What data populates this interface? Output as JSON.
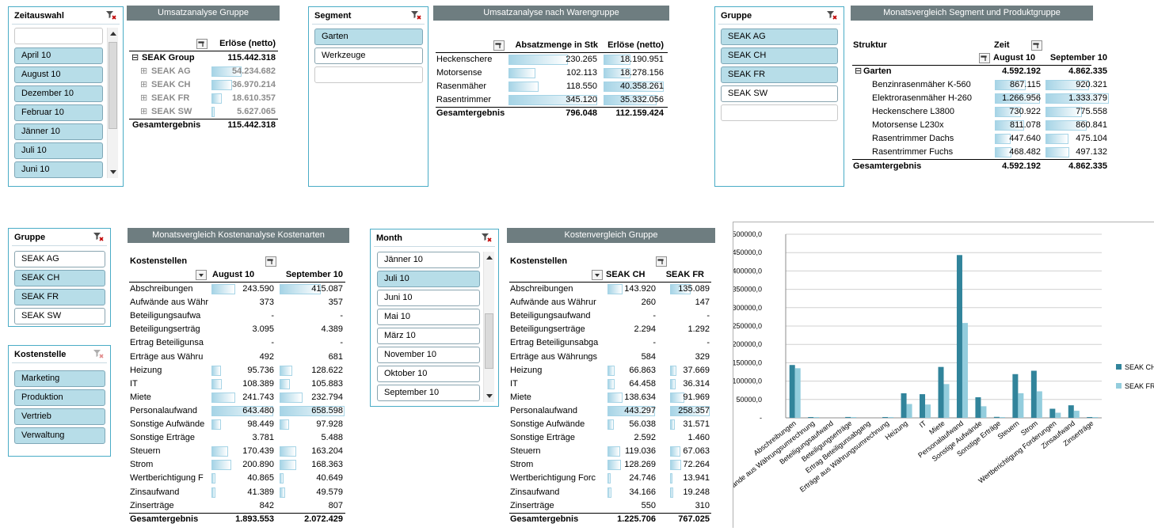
{
  "slicers": {
    "zeitauswahl": {
      "title": "Zeitauswahl",
      "items": [
        "",
        "April 10",
        "August 10",
        "Dezember 10",
        "Februar 10",
        "Jänner 10",
        "Juli 10",
        "Juni 10"
      ]
    },
    "segment": {
      "title": "Segment",
      "items": [
        "Garten",
        "Werkzeuge",
        ""
      ]
    },
    "gruppe_top": {
      "title": "Gruppe",
      "items": [
        "SEAK AG",
        "SEAK CH",
        "SEAK FR",
        "SEAK SW",
        ""
      ]
    },
    "gruppe_bottom": {
      "title": "Gruppe",
      "items": [
        "SEAK AG",
        "SEAK CH",
        "SEAK FR",
        "SEAK SW"
      ]
    },
    "kostenstelle": {
      "title": "Kostenstelle",
      "items": [
        "Marketing",
        "Produktion",
        "Vertrieb",
        "Verwaltung"
      ]
    },
    "month": {
      "title": "Month",
      "items": [
        "Jänner 10",
        "Juli 10",
        "Juni 10",
        "Mai 10",
        "März 10",
        "November 10",
        "Oktober 10",
        "September 10"
      ]
    }
  },
  "umsatz_gruppe": {
    "title": "Umsatzanalyse Gruppe",
    "header": "Erlöse (netto)",
    "rows": [
      {
        "label": "SEAK Group",
        "value": "115.442.318",
        "bar": 1.0
      },
      {
        "label": "SEAK AG",
        "value": "54.234.682",
        "bar": 0.47
      },
      {
        "label": "SEAK CH",
        "value": "36.970.214",
        "bar": 0.32
      },
      {
        "label": "SEAK FR",
        "value": "18.610.357",
        "bar": 0.16
      },
      {
        "label": "SEAK SW",
        "value": "5.627.065",
        "bar": 0.05
      }
    ],
    "total_label": "Gesamtergebnis",
    "total_value": "115.442.318"
  },
  "umsatz_waren": {
    "title": "Umsatzanalyse nach Warengruppe",
    "header1": "Absatzmenge in Stk",
    "header2": "Erlöse (netto)",
    "rows": [
      {
        "label": "Heckenschere",
        "v1": "230.265",
        "v2": "18.190.951",
        "b1": 0.67,
        "b2": 0.45
      },
      {
        "label": "Motorsense",
        "v1": "102.113",
        "v2": "18.278.156",
        "b1": 0.3,
        "b2": 0.45
      },
      {
        "label": "Rasenmäher",
        "v1": "118.550",
        "v2": "40.358.261",
        "b1": 0.34,
        "b2": 1.0
      },
      {
        "label": "Rasentrimmer",
        "v1": "345.120",
        "v2": "35.332.056",
        "b1": 1.0,
        "b2": 0.88
      }
    ],
    "total_label": "Gesamtergebnis",
    "total_v1": "796.048",
    "total_v2": "112.159.424"
  },
  "monatsvergleich_segment": {
    "title": "Monatsvergleich Segment und Produktgruppe",
    "h_struktur": "Struktur",
    "h_zeit": "Zeit",
    "h_aug": "August 10",
    "h_sep": "September 10",
    "group_label": "Garten",
    "group_aug": "4.592.192",
    "group_sep": "4.862.335",
    "rows": [
      {
        "label": "Benzinrasenmäher K-560",
        "aug": "867.115",
        "sep": "920.321",
        "ba": 0.65,
        "bs": 0.69
      },
      {
        "label": "Elektrorasenmäher H-260",
        "aug": "1.266.956",
        "sep": "1.333.379",
        "ba": 0.95,
        "bs": 1.0
      },
      {
        "label": "Heckenschere L3800",
        "aug": "730.922",
        "sep": "775.558",
        "ba": 0.55,
        "bs": 0.58
      },
      {
        "label": "Motorsense L230x",
        "aug": "811.078",
        "sep": "860.841",
        "ba": 0.61,
        "bs": 0.65
      },
      {
        "label": "Rasentrimmer Dachs",
        "aug": "447.640",
        "sep": "475.104",
        "ba": 0.34,
        "bs": 0.36
      },
      {
        "label": "Rasentrimmer Fuchs",
        "aug": "468.482",
        "sep": "497.132",
        "ba": 0.35,
        "bs": 0.37
      }
    ],
    "total_label": "Gesamtergebnis",
    "total_aug": "4.592.192",
    "total_sep": "4.862.335"
  },
  "kostenarten": {
    "title": "Monatsvergleich Kostenanalyse Kostenarten",
    "h_kst": "Kostenstellen",
    "h_aug": "August 10",
    "h_sep": "September 10",
    "rows": [
      {
        "label": "Abschreibungen",
        "aug": "243.590",
        "sep": "415.087",
        "ba": 0.37,
        "bs": 0.63
      },
      {
        "label": "Aufwände aus Währ",
        "aug": "373",
        "sep": "357",
        "ba": 0,
        "bs": 0
      },
      {
        "label": "Beteiligungsaufwa",
        "aug": "-",
        "sep": "-",
        "ba": 0,
        "bs": 0
      },
      {
        "label": "Beteiligungserträg",
        "aug": "3.095",
        "sep": "4.389",
        "ba": 0,
        "bs": 0
      },
      {
        "label": "Ertrag Beteiligunsa",
        "aug": "-",
        "sep": "-",
        "ba": 0,
        "bs": 0
      },
      {
        "label": "Erträge aus Währu",
        "aug": "492",
        "sep": "681",
        "ba": 0,
        "bs": 0
      },
      {
        "label": "Heizung",
        "aug": "95.736",
        "sep": "128.622",
        "ba": 0.15,
        "bs": 0.2
      },
      {
        "label": "IT",
        "aug": "108.389",
        "sep": "105.883",
        "ba": 0.16,
        "bs": 0.16
      },
      {
        "label": "Miete",
        "aug": "241.743",
        "sep": "232.794",
        "ba": 0.37,
        "bs": 0.35
      },
      {
        "label": "Personalaufwand",
        "aug": "643.480",
        "sep": "658.598",
        "ba": 0.98,
        "bs": 1.0
      },
      {
        "label": "Sonstige Aufwände",
        "aug": "98.449",
        "sep": "97.928",
        "ba": 0.15,
        "bs": 0.15
      },
      {
        "label": "Sonstige Erträge",
        "aug": "3.781",
        "sep": "5.488",
        "ba": 0,
        "bs": 0
      },
      {
        "label": "Steuern",
        "aug": "170.439",
        "sep": "163.204",
        "ba": 0.26,
        "bs": 0.25
      },
      {
        "label": "Strom",
        "aug": "200.890",
        "sep": "168.363",
        "ba": 0.31,
        "bs": 0.26
      },
      {
        "label": "Wertberichtigung F",
        "aug": "40.865",
        "sep": "40.649",
        "ba": 0.06,
        "bs": 0.06
      },
      {
        "label": "Zinsaufwand",
        "aug": "41.389",
        "sep": "49.579",
        "ba": 0.06,
        "bs": 0.08
      },
      {
        "label": "Zinserträge",
        "aug": "842",
        "sep": "807",
        "ba": 0,
        "bs": 0
      }
    ],
    "total_label": "Gesamtergebnis",
    "total_aug": "1.893.553",
    "total_sep": "2.072.429"
  },
  "kostenvergleich": {
    "title": "Kostenvergleich Gruppe",
    "h_kst": "Kostenstellen",
    "h_ch": "SEAK CH",
    "h_fr": "SEAK FR",
    "rows": [
      {
        "label": "Abschreibungen",
        "ch": "143.920",
        "fr": "135.089",
        "bc": 0.32,
        "bf": 0.52
      },
      {
        "label": "Aufwände aus Währur",
        "ch": "260",
        "fr": "147",
        "bc": 0,
        "bf": 0
      },
      {
        "label": "Beteiligungsaufwand",
        "ch": "-",
        "fr": "-",
        "bc": 0,
        "bf": 0
      },
      {
        "label": "Beteiligungserträge",
        "ch": "2.294",
        "fr": "1.292",
        "bc": 0,
        "bf": 0
      },
      {
        "label": "Ertrag Beteiligunsabga",
        "ch": "-",
        "fr": "-",
        "bc": 0,
        "bf": 0
      },
      {
        "label": "Erträge aus Währungs",
        "ch": "584",
        "fr": "329",
        "bc": 0,
        "bf": 0
      },
      {
        "label": "Heizung",
        "ch": "66.863",
        "fr": "37.669",
        "bc": 0.15,
        "bf": 0.15
      },
      {
        "label": "IT",
        "ch": "64.458",
        "fr": "36.314",
        "bc": 0.15,
        "bf": 0.14
      },
      {
        "label": "Miete",
        "ch": "138.634",
        "fr": "91.969",
        "bc": 0.31,
        "bf": 0.36
      },
      {
        "label": "Personalaufwand",
        "ch": "443.297",
        "fr": "258.357",
        "bc": 1.0,
        "bf": 1.0
      },
      {
        "label": "Sonstige Aufwände",
        "ch": "56.038",
        "fr": "31.571",
        "bc": 0.13,
        "bf": 0.12
      },
      {
        "label": "Sonstige Erträge",
        "ch": "2.592",
        "fr": "1.460",
        "bc": 0,
        "bf": 0
      },
      {
        "label": "Steuern",
        "ch": "119.036",
        "fr": "67.063",
        "bc": 0.27,
        "bf": 0.26
      },
      {
        "label": "Strom",
        "ch": "128.269",
        "fr": "72.264",
        "bc": 0.29,
        "bf": 0.28
      },
      {
        "label": "Wertberichtigung Forc",
        "ch": "24.746",
        "fr": "13.941",
        "bc": 0.06,
        "bf": 0.05
      },
      {
        "label": "Zinsaufwand",
        "ch": "34.166",
        "fr": "19.248",
        "bc": 0.08,
        "bf": 0.07
      },
      {
        "label": "Zinserträge",
        "ch": "550",
        "fr": "310",
        "bc": 0,
        "bf": 0
      }
    ],
    "total_label": "Gesamtergebnis",
    "total_ch": "1.225.706",
    "total_fr": "767.025"
  },
  "chart_data": {
    "type": "bar",
    "categories": [
      "Abschreibungen",
      "Aufwände aus Währungsumrechnung",
      "Beteiligungsaufwand",
      "Beteiligungserträge",
      "Ertrag Beteiligunsabgang",
      "Erträge aus Währungsumrechnung",
      "Heizung",
      "IT",
      "Miete",
      "Personalaufwand",
      "Sonstige Aufwände",
      "Sonstige Erträge",
      "Steuern",
      "Strom",
      "Wertberichtigung Forderungen",
      "Zinsaufwand",
      "Zinserträge"
    ],
    "y_ticks": [
      "500000,0",
      "450000,0",
      "400000,0",
      "350000,0",
      "300000,0",
      "250000,0",
      "200000,0",
      "150000,0",
      "100000,0",
      "50000,0",
      "-"
    ],
    "ylim": [
      0,
      500000
    ],
    "series": [
      {
        "name": "SEAK CH",
        "color": "#31849b",
        "values": [
          143920,
          260,
          0,
          2294,
          0,
          584,
          66863,
          64458,
          138634,
          443297,
          56038,
          2592,
          119036,
          128269,
          24746,
          34166,
          550
        ]
      },
      {
        "name": "SEAK FR",
        "color": "#93cddd",
        "values": [
          135089,
          147,
          0,
          1292,
          0,
          329,
          37669,
          36314,
          91969,
          258357,
          31571,
          1460,
          67063,
          72264,
          13941,
          19248,
          310
        ]
      }
    ],
    "legend": "right",
    "grid": true
  }
}
